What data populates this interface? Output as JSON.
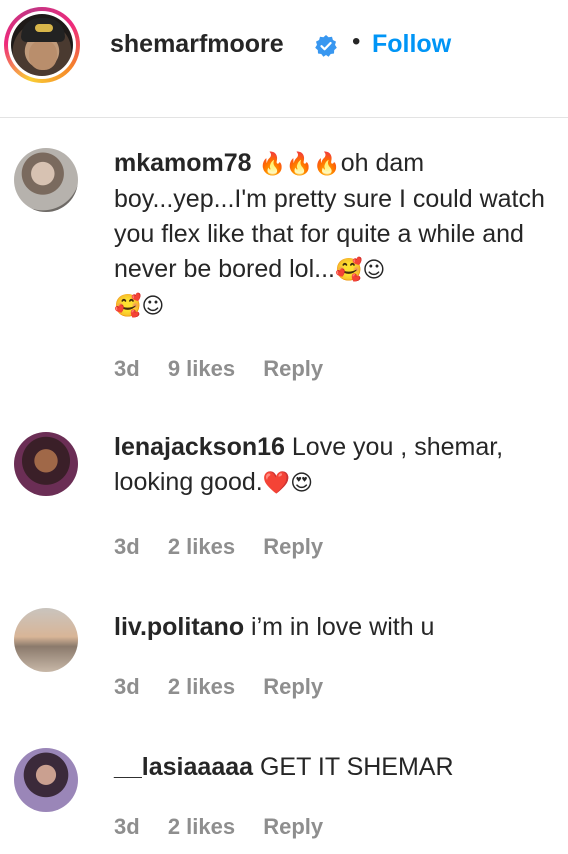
{
  "post": {
    "username": "shemarfmoore",
    "separator": "•",
    "follow_label": "Follow"
  },
  "comments": [
    {
      "username": "mkamom78",
      "text_parts": [
        "🔥🔥🔥",
        "oh dam boy...yep...I'm pretty sure I could watch you flex like that for quite a while and never be bored lol...",
        "🥰☺",
        "🥰☺"
      ],
      "time": "3d",
      "likes": "9 likes",
      "reply_label": "Reply"
    },
    {
      "username": "lenajackson16",
      "text_parts": [
        "Love you , shemar, looking good.",
        "❤️😍"
      ],
      "time": "3d",
      "likes": "2 likes",
      "reply_label": "Reply"
    },
    {
      "username": "liv.politano",
      "text_parts": [
        "i’m in love with u"
      ],
      "time": "3d",
      "likes": "2 likes",
      "reply_label": "Reply"
    },
    {
      "username": "__lasiaaaaa",
      "text_parts": [
        "GET IT SHEMAR"
      ],
      "time": "3d",
      "likes": "2 likes",
      "reply_label": "Reply"
    }
  ],
  "colors": {
    "accent": "#0095f6",
    "text": "#262626",
    "meta": "#8e8e8e",
    "verified": "#3897f0"
  }
}
